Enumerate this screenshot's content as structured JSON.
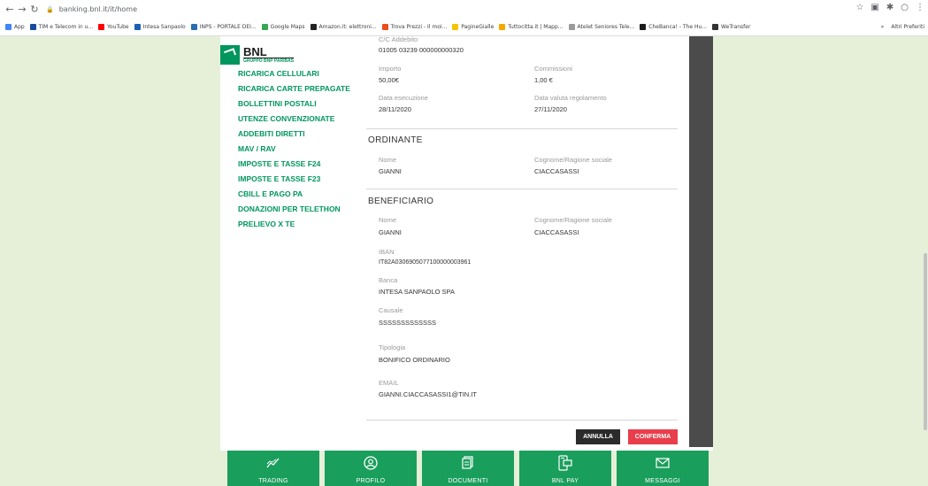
{
  "browser": {
    "url": "banking.bnl.it/it/home",
    "bookmarks": [
      {
        "label": "App",
        "color": "#4285f4"
      },
      {
        "label": "TIM e Telecom in u...",
        "color": "#1a4a9c"
      },
      {
        "label": "YouTube",
        "color": "#ff0000"
      },
      {
        "label": "Intesa Sanpaolo",
        "color": "#1a5fb4"
      },
      {
        "label": "INPS - PORTALE DEI...",
        "color": "#2a6db0"
      },
      {
        "label": "Google Maps",
        "color": "#34a853"
      },
      {
        "label": "Amazon.it: elettroni...",
        "color": "#222222"
      },
      {
        "label": "Trova Prezzi - Il moi...",
        "color": "#e94e1b"
      },
      {
        "label": "PagineGialle",
        "color": "#f6c400"
      },
      {
        "label": "Tuttocitta.it | Mapp...",
        "color": "#f6a800"
      },
      {
        "label": "Atelet Seniores Tele...",
        "color": "#9a9a9a"
      },
      {
        "label": "CheBanca! - The Hu...",
        "color": "#1a1a1a"
      },
      {
        "label": "WeTransfer",
        "color": "#333333"
      }
    ],
    "bookmarks_more": "»",
    "other_bookmarks": "Altri Preferiti"
  },
  "logo": {
    "name": "BNL",
    "sub": "GRUPPO BNP PARIBAS"
  },
  "menu": [
    "RICARICA CELLULARI",
    "RICARICA CARTE PREPAGATE",
    "BOLLETTINI POSTALI",
    "UTENZE CONVENZIONATE",
    "ADDEBITI DIRETTI",
    "MAV / RAV",
    "IMPOSTE E TASSE F24",
    "IMPOSTE E TASSE F23",
    "CBILL E PAGO PA",
    "DONAZIONI PER TELETHON",
    "PRELIEVO X TE"
  ],
  "details": {
    "conto_label": "C/C Addebito",
    "conto": "01005 03239 000000000320",
    "importo_label": "Importo",
    "importo": "50,00€",
    "commissioni_label": "Commissioni",
    "commissioni": "1,00 €",
    "data_esecuzione_label": "Data esecuzione",
    "data_esecuzione": "28/11/2020",
    "data_valuta_label": "Data valuta regolamento",
    "data_valuta": "27/11/2020"
  },
  "ordinante": {
    "title": "ORDINANTE",
    "nome_label": "Nome",
    "nome": "GIANNI",
    "cognome_label": "Cognome/Ragione sociale",
    "cognome": "CIACCASASSI"
  },
  "beneficiario": {
    "title": "BENEFICIARIO",
    "nome_label": "Nome",
    "nome": "GIANNI",
    "cognome_label": "Cognome/Ragione sociale",
    "cognome": "CIACCASASSI",
    "iban_label": "IBAN",
    "iban": "IT82A0306905077100000003961",
    "banca_label": "Banca",
    "banca": "INTESA SANPAOLO SPA",
    "causale_label": "Causale",
    "causale": "SSSSSSSSSSSSS",
    "tipologia_label": "Tipologia",
    "tipologia": "BONIFICO ORDINARIO",
    "email_label": "EMAIL",
    "email": "GIANNI.CIACCASASSI1@TIN.IT"
  },
  "actions": {
    "annulla": "ANNULLA",
    "conferma": "CONFERMA"
  },
  "bottom_nav": [
    {
      "label": "TRADING",
      "icon": "trading-icon"
    },
    {
      "label": "PROFILO",
      "icon": "profile-icon"
    },
    {
      "label": "DOCUMENTI",
      "icon": "document-icon"
    },
    {
      "label": "BNL PAY",
      "icon": "bnl-pay-icon"
    },
    {
      "label": "MESSAGGI",
      "icon": "mail-icon"
    }
  ],
  "colors": {
    "brand_green": "#00965e",
    "tile_green": "#1a9e5c",
    "confirm_red": "#e83e4c",
    "cancel_dark": "#2b2b2b"
  }
}
